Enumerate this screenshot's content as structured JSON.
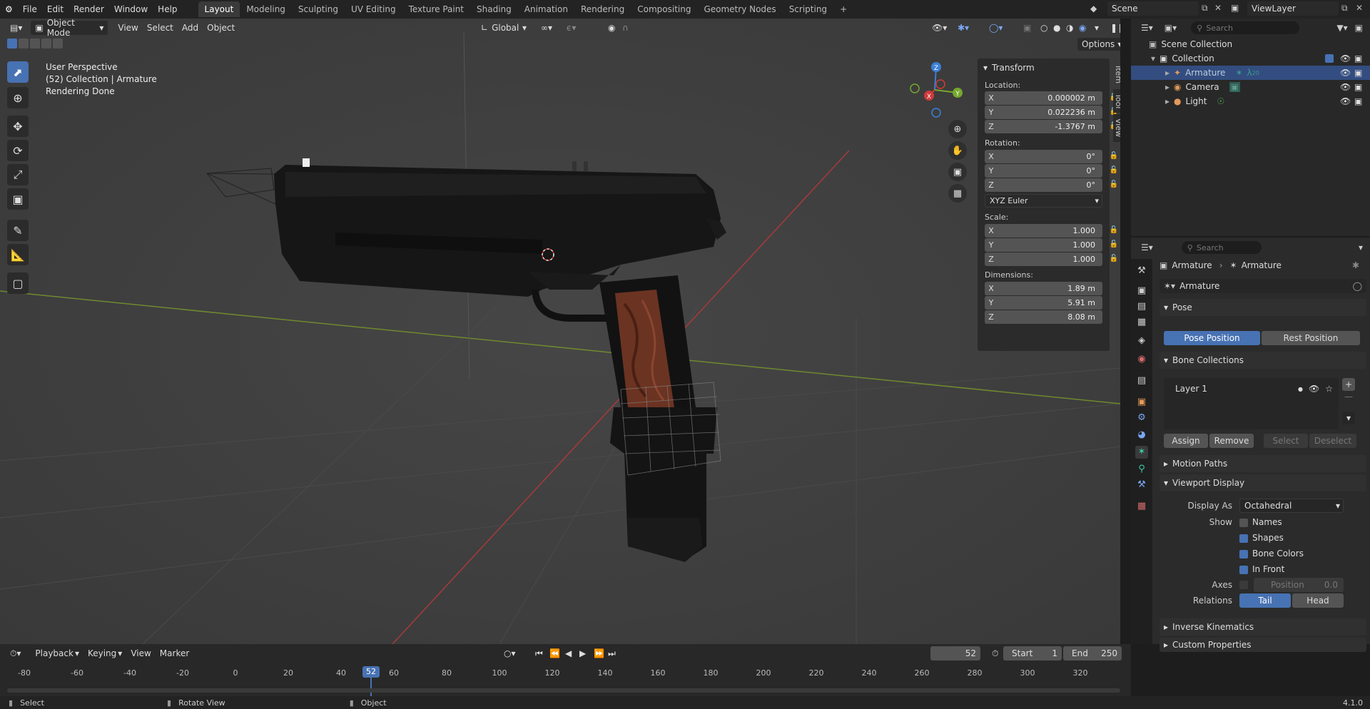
{
  "topbar": {
    "menus": [
      "File",
      "Edit",
      "Render",
      "Window",
      "Help"
    ],
    "workspaces": [
      "Layout",
      "Modeling",
      "Sculpting",
      "UV Editing",
      "Texture Paint",
      "Shading",
      "Animation",
      "Rendering",
      "Compositing",
      "Geometry Nodes",
      "Scripting"
    ],
    "active_workspace": "Layout",
    "add_tab": "+",
    "scene": "Scene",
    "view_layer": "ViewLayer"
  },
  "viewport": {
    "mode": "Object Mode",
    "menus": [
      "View",
      "Select",
      "Add",
      "Object"
    ],
    "orientation": "Global",
    "options": "Options",
    "info": {
      "line1": "User Perspective",
      "line2": "(52) Collection | Armature",
      "line3": "Rendering Done"
    },
    "side_tabs": [
      "Item",
      "Tool",
      "View"
    ],
    "gizmo": {
      "x": "X",
      "y": "Y",
      "z": "Z"
    }
  },
  "transform": {
    "title": "Transform",
    "location_label": "Location:",
    "location": [
      {
        "axis": "X",
        "value": "0.000002 m"
      },
      {
        "axis": "Y",
        "value": "0.022236 m"
      },
      {
        "axis": "Z",
        "value": "-1.3767 m"
      }
    ],
    "rotation_label": "Rotation:",
    "rotation": [
      {
        "axis": "X",
        "value": "0°"
      },
      {
        "axis": "Y",
        "value": "0°"
      },
      {
        "axis": "Z",
        "value": "0°"
      }
    ],
    "rotation_mode": "XYZ Euler",
    "scale_label": "Scale:",
    "scale": [
      {
        "axis": "X",
        "value": "1.000"
      },
      {
        "axis": "Y",
        "value": "1.000"
      },
      {
        "axis": "Z",
        "value": "1.000"
      }
    ],
    "dimensions_label": "Dimensions:",
    "dimensions": [
      {
        "axis": "X",
        "value": "1.89 m"
      },
      {
        "axis": "Y",
        "value": "5.91 m"
      },
      {
        "axis": "Z",
        "value": "8.08 m"
      }
    ]
  },
  "outliner": {
    "search_placeholder": "Search",
    "scene_collection": "Scene Collection",
    "collection": "Collection",
    "items": [
      "Armature",
      "Camera",
      "Light"
    ],
    "armature_badge": "20"
  },
  "properties": {
    "search_placeholder": "Search",
    "breadcrumb": [
      "Armature",
      "Armature"
    ],
    "data_name": "Armature",
    "pose": {
      "title": "Pose",
      "pose_position": "Pose Position",
      "rest_position": "Rest Position"
    },
    "bone_collections": {
      "title": "Bone Collections",
      "layer": "Layer 1",
      "assign": "Assign",
      "remove": "Remove",
      "select": "Select",
      "deselect": "Deselect"
    },
    "motion_paths": "Motion Paths",
    "viewport_display": {
      "title": "Viewport Display",
      "display_as_label": "Display As",
      "display_as": "Octahedral",
      "show_label": "Show",
      "names": "Names",
      "shapes": "Shapes",
      "bone_colors": "Bone Colors",
      "in_front": "In Front",
      "axes_label": "Axes",
      "position_label": "Position",
      "position_value": "0.0",
      "relations_label": "Relations",
      "tail": "Tail",
      "head": "Head"
    },
    "inverse_kinematics": "Inverse Kinematics",
    "custom_properties": "Custom Properties"
  },
  "timeline": {
    "menus": [
      "Playback",
      "Keying",
      "View",
      "Marker"
    ],
    "current_frame": "52",
    "start_label": "Start",
    "start": "1",
    "end_label": "End",
    "end": "250",
    "ticks": [
      "-80",
      "-60",
      "-40",
      "-20",
      "0",
      "20",
      "40",
      "60",
      "80",
      "100",
      "120",
      "140",
      "160",
      "180",
      "200",
      "220",
      "240",
      "260",
      "280",
      "300",
      "320"
    ],
    "playhead": "52"
  },
  "statusbar": {
    "select": "Select",
    "rotate_view": "Rotate View",
    "object": "Object",
    "version": "4.1.0"
  }
}
